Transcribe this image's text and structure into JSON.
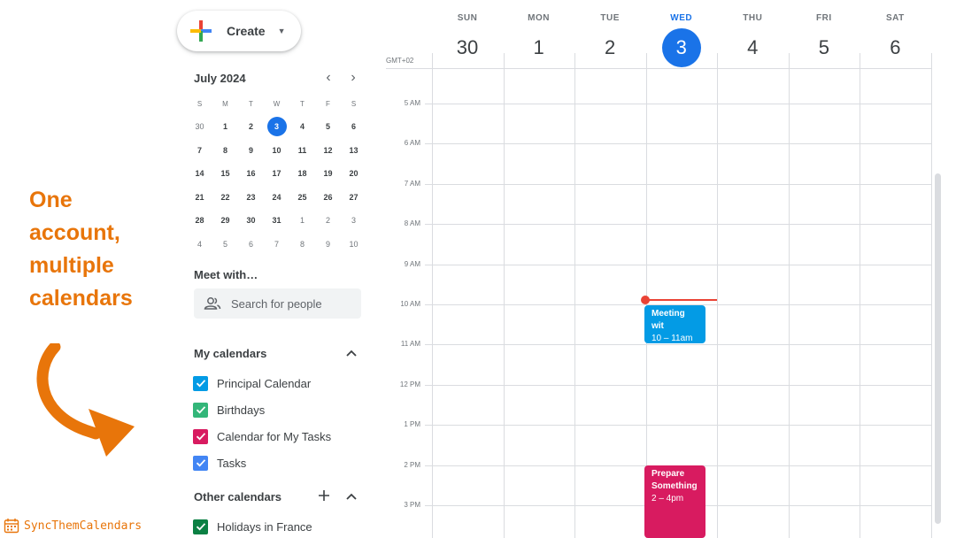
{
  "promo": {
    "lines": [
      "One",
      "account,",
      "multiple",
      "calendars"
    ],
    "brand": "SyncThemCalendars",
    "color": "#e8750a"
  },
  "create_button": {
    "label": "Create"
  },
  "mini_calendar": {
    "title": "July 2024",
    "weekday_letters": [
      "S",
      "M",
      "T",
      "W",
      "T",
      "F",
      "S"
    ],
    "weeks": [
      [
        "30",
        "1",
        "2",
        "3",
        "4",
        "5",
        "6"
      ],
      [
        "7",
        "8",
        "9",
        "10",
        "11",
        "12",
        "13"
      ],
      [
        "14",
        "15",
        "16",
        "17",
        "18",
        "19",
        "20"
      ],
      [
        "21",
        "22",
        "23",
        "24",
        "25",
        "26",
        "27"
      ],
      [
        "28",
        "29",
        "30",
        "31",
        "1",
        "2",
        "3"
      ],
      [
        "4",
        "5",
        "6",
        "7",
        "8",
        "9",
        "10"
      ]
    ]
  },
  "meet_with": {
    "title": "Meet with…",
    "search_label": "Search for people"
  },
  "my_calendars": {
    "title": "My calendars",
    "items": [
      {
        "label": "Principal Calendar",
        "color": "#039be5"
      },
      {
        "label": "Birthdays",
        "color": "#33b679"
      },
      {
        "label": "Calendar for My Tasks",
        "color": "#d81b60"
      },
      {
        "label": "Tasks",
        "color": "#4285f4"
      }
    ]
  },
  "other_calendars": {
    "title": "Other calendars",
    "items": [
      {
        "label": "Holidays in France",
        "color": "#0b8043"
      }
    ]
  },
  "week": {
    "timezone": "GMT+02",
    "days": [
      {
        "dow": "SUN",
        "num": "30"
      },
      {
        "dow": "MON",
        "num": "1"
      },
      {
        "dow": "TUE",
        "num": "2"
      },
      {
        "dow": "WED",
        "num": "3"
      },
      {
        "dow": "THU",
        "num": "4"
      },
      {
        "dow": "FRI",
        "num": "5"
      },
      {
        "dow": "SAT",
        "num": "6"
      }
    ],
    "hours": [
      "5 AM",
      "6 AM",
      "7 AM",
      "8 AM",
      "9 AM",
      "10 AM",
      "11 AM",
      "12 PM",
      "1 PM",
      "2 PM",
      "3 PM"
    ]
  },
  "events": [
    {
      "title": "Meeting wit",
      "time": "10 – 11am",
      "color": "#039be5"
    },
    {
      "title": "Prepare Something",
      "time": "2 – 4pm",
      "color": "#d81b60"
    }
  ]
}
